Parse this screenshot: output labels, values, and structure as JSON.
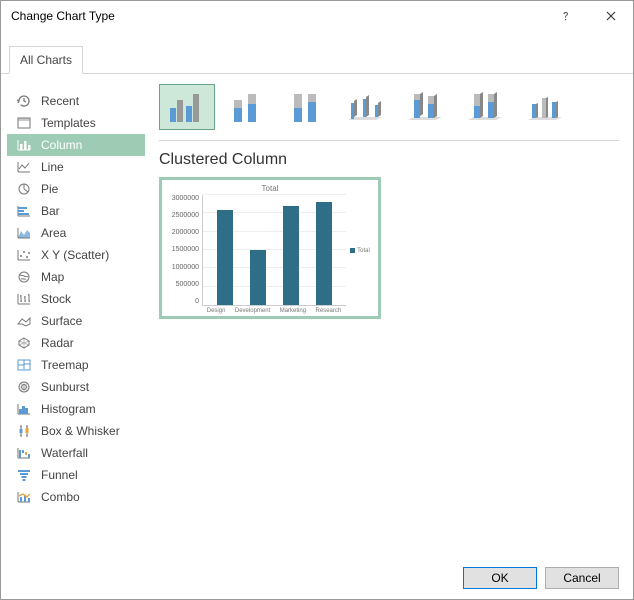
{
  "window": {
    "title": "Change Chart Type"
  },
  "tabs": {
    "all_charts": "All Charts"
  },
  "sidebar": {
    "items": [
      {
        "label": "Recent"
      },
      {
        "label": "Templates"
      },
      {
        "label": "Column"
      },
      {
        "label": "Line"
      },
      {
        "label": "Pie"
      },
      {
        "label": "Bar"
      },
      {
        "label": "Area"
      },
      {
        "label": "X Y (Scatter)"
      },
      {
        "label": "Map"
      },
      {
        "label": "Stock"
      },
      {
        "label": "Surface"
      },
      {
        "label": "Radar"
      },
      {
        "label": "Treemap"
      },
      {
        "label": "Sunburst"
      },
      {
        "label": "Histogram"
      },
      {
        "label": "Box & Whisker"
      },
      {
        "label": "Waterfall"
      },
      {
        "label": "Funnel"
      },
      {
        "label": "Combo"
      }
    ]
  },
  "section": {
    "title": "Clustered Column"
  },
  "buttons": {
    "ok": "OK",
    "cancel": "Cancel"
  },
  "preview": {
    "title": "Total",
    "legend": "Total",
    "yaxis": [
      "3000000",
      "2500000",
      "2000000",
      "1500000",
      "1000000",
      "500000",
      "0"
    ]
  },
  "chart_data": {
    "type": "bar",
    "title": "Total",
    "categories": [
      "Design",
      "Development",
      "Marketing",
      "Research"
    ],
    "values": [
      2600000,
      1500000,
      2700000,
      2800000
    ],
    "series": [
      {
        "name": "Total",
        "values": [
          2600000,
          1500000,
          2700000,
          2800000
        ]
      }
    ],
    "xlabel": "",
    "ylabel": "",
    "ylim": [
      0,
      3000000
    ]
  }
}
